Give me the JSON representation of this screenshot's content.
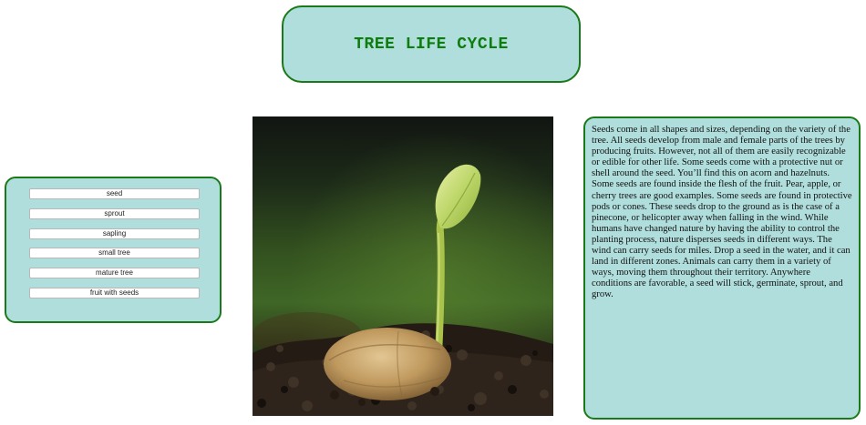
{
  "title": "TREE LIFE CYCLE",
  "stages": [
    "seed",
    "sprout",
    "sapling",
    "small tree",
    "mature tree",
    "fruit with seeds"
  ],
  "description": "Seeds come in all shapes and sizes, depending on the variety of the tree. All seeds develop from male and female parts of the trees by producing fruits. However, not all of them are easily recognizable or edible for other life. Some seeds come with a protective nut or shell around the seed. You’ll find this on acorn and hazelnuts. Some seeds are found inside the flesh of the fruit. Pear, apple, or cherry trees are good examples. Some seeds are found in protective pods or cones. These seeds drop to the ground as is the case of a pinecone, or helicopter away when falling in the wind. While humans have changed nature by having the ability to control the planting process, nature disperses seeds in different ways. The wind can carry seeds for miles. Drop a seed in the water, and it can land in different zones. Animals can carry them in a variety of ways, moving them throughout their territory. Anywhere conditions are favorable, a seed will stick, germinate, sprout, and grow.",
  "colors": {
    "panel_bg": "#b0dedc",
    "panel_border": "#1a7a1a",
    "title_color": "#0d7d0d"
  }
}
